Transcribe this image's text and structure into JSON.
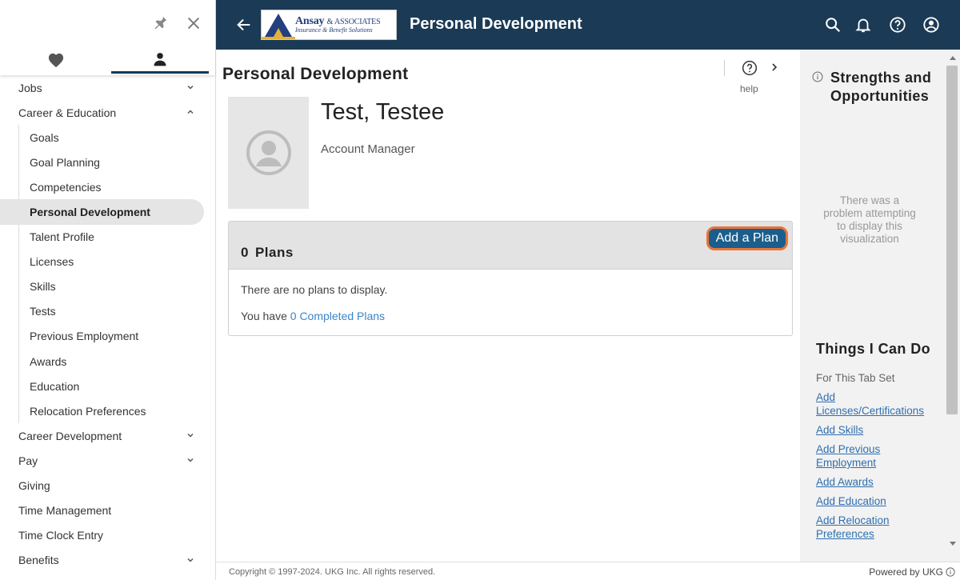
{
  "sidebar": {
    "items": [
      {
        "label": "Jobs"
      },
      {
        "label": "Career & Education"
      },
      {
        "label": "Career Development"
      },
      {
        "label": "Pay"
      },
      {
        "label": "Giving"
      },
      {
        "label": "Time Management"
      },
      {
        "label": "Time Clock Entry"
      },
      {
        "label": "Benefits"
      }
    ],
    "subitems": [
      {
        "label": "Goals"
      },
      {
        "label": "Goal Planning"
      },
      {
        "label": "Competencies"
      },
      {
        "label": "Personal Development"
      },
      {
        "label": "Talent Profile"
      },
      {
        "label": "Licenses"
      },
      {
        "label": "Skills"
      },
      {
        "label": "Tests"
      },
      {
        "label": "Previous Employment"
      },
      {
        "label": "Awards"
      },
      {
        "label": "Education"
      },
      {
        "label": "Relocation Preferences"
      }
    ]
  },
  "header": {
    "logo_main": "Ansay",
    "logo_amp": "& ASSOCIATES",
    "logo_sub": "Insurance & Benefit Solutions",
    "title": "Personal Development"
  },
  "main": {
    "page_title": "Personal Development",
    "help_label": "help",
    "person_name": "Test, Testee",
    "person_role": "Account Manager",
    "plans_count": "0",
    "plans_label": "Plans",
    "add_plan_label": "Add a Plan",
    "empty_text": "There are no plans to display.",
    "completed_prefix": "You have",
    "completed_link": "0 Completed Plans"
  },
  "rpanel": {
    "so_title": "Strengths and Opportunities",
    "viz_error": "There was a problem attempting to display this visualization",
    "tcd_title": "Things I Can Do",
    "tcd_sub": "For This Tab Set",
    "links": [
      {
        "label": "Add Licenses/Certifications"
      },
      {
        "label": "Add Skills"
      },
      {
        "label": "Add Previous Employment"
      },
      {
        "label": "Add Awards"
      },
      {
        "label": "Add Education"
      },
      {
        "label": "Add Relocation Preferences"
      }
    ]
  },
  "footer": {
    "copyright": "Copyright © 1997-2024. UKG Inc. All rights reserved.",
    "powered": "Powered by UKG"
  },
  "colors": {
    "header_bg": "#1b3a55",
    "accent_button": "#1b5e8c",
    "focus_ring": "#e8743b",
    "link": "#2f6fae"
  }
}
